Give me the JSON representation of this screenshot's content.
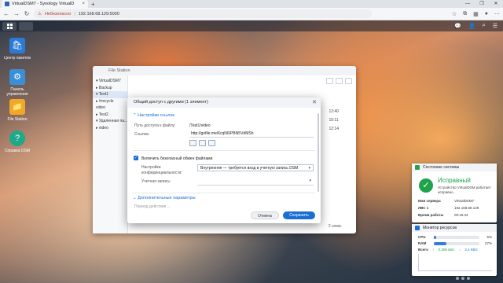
{
  "browser": {
    "tab_title": "VirtualDSM7 - Synology VirtualD",
    "tab_close": "×",
    "new_tab": "+",
    "security": "Небезопасно",
    "url": "192.168.68.129:5000",
    "window_controls": [
      "—",
      "❐",
      "✕"
    ]
  },
  "desktop": {
    "icons": [
      {
        "label": "Центр пакетов",
        "glyph": "🛍",
        "color": "#2b7bd6"
      },
      {
        "label": "Панель управления",
        "glyph": "⚙",
        "color": "#3a8fd9"
      },
      {
        "label": "File Station",
        "glyph": "📁",
        "color": "#f2a728"
      },
      {
        "label": "Справка DSM",
        "glyph": "?",
        "color": "#1fa88a"
      }
    ]
  },
  "file_station": {
    "title": "File Station",
    "tree": [
      {
        "label": "▾ VirtualDSM7",
        "selected": false
      },
      {
        "label": "  ▸ Backup",
        "selected": false
      },
      {
        "label": "  ▾ Test1",
        "selected": true
      },
      {
        "label": "     ▸ #recycle",
        "selected": false
      },
      {
        "label": "       video",
        "selected": false
      },
      {
        "label": "  ▸ Test2",
        "selected": false
      },
      {
        "label": "▾ Удаленная па...",
        "selected": false
      },
      {
        "label": "  ▸ video",
        "selected": false
      }
    ],
    "times": [
      "12:40",
      "15:11",
      "12:14"
    ],
    "footer": "2 элем."
  },
  "dialog": {
    "title": "Общий доступ с другими (1 элемент)",
    "close": "✕",
    "section_link": "⌃ Настройки ссылок",
    "path_label": "Путь доступа к файлу:",
    "path_value": "/Test1/video",
    "link_label": "Ссылка:",
    "link_value": "http://gofile.me/6cqN6/PBN5VdMSh",
    "checkbox_label": "Включить безопасный обмен файлами",
    "privacy_label": "Настройки конфиденциальности:",
    "privacy_value": "Внутренняя — требуется вход в учетную запись DSM",
    "account_label": "Учетная запись:",
    "section_more": "⌄ Дополнительные параметры",
    "more_hint": "Период действия ...",
    "cancel": "Отмена",
    "save": "Сохранить"
  },
  "health": {
    "title": "Состояние системы",
    "status": "Исправный",
    "description": "Устройство VirtualDSM работает исправно.",
    "rows": [
      {
        "key": "Имя сервера",
        "value": "VirtualDSM7"
      },
      {
        "key": "ЛВС 1",
        "value": "192.168.68.129"
      },
      {
        "key": "Время работы",
        "value": "00:15:34"
      }
    ]
  },
  "resmon": {
    "title": "Монитор ресурсов",
    "cpu_label": "CPU",
    "cpu_pct": 5,
    "cpu_text": "5%",
    "ram_label": "RAM",
    "ram_pct": 27,
    "ram_text": "27%",
    "net_label": "Всего",
    "net_up": "0.306 кБ/с",
    "net_down": "2.4 КБ/с"
  },
  "colors": {
    "accent": "#1a6dd2",
    "ok": "#1fa34a"
  }
}
